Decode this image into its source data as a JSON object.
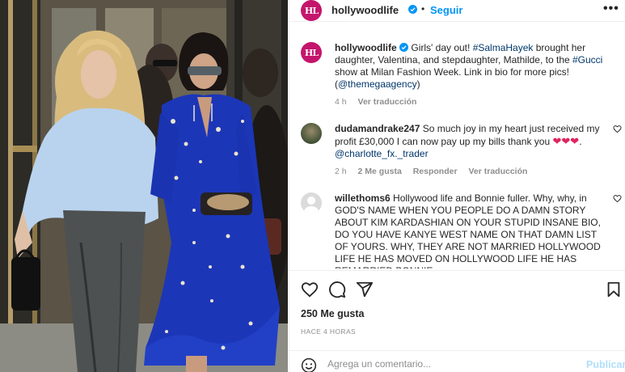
{
  "post": {
    "author": "hollywoodlife",
    "avatar_initials": "HL",
    "follow_label": "Seguir",
    "separator": "•",
    "more_label": "•••",
    "caption_parts": [
      "Girls' day out! ",
      "#SalmaHayek",
      " brought her daughter, Valentina, and stepdaughter, Mathilde, to the ",
      "#Gucci",
      " show at Milan Fashion Week. Link in bio for more pics! (",
      "@themegaagency",
      ")"
    ],
    "caption_time": "4 h",
    "caption_translate": "Ver traducción"
  },
  "comments": [
    {
      "user": "dudamandrake247",
      "text": "So much joy in my heart just received my profit £30,000 I can now pay up my bills thank you",
      "hearts": "❤❤❤",
      "tail_pre": ". ",
      "mention": "@charlotte_fx._trader",
      "time": "2 h",
      "likes": "2 Me gusta",
      "reply": "Responder",
      "translate": "Ver traducción"
    },
    {
      "user": "willethoms6",
      "text": "Hollywood life and Bonnie fuller. Why, why, in GOD'S NAME WHEN YOU PEOPLE DO A DAMN STORY ABOUT KIM KARDASHIAN ON YOUR STUPID INSANE BIO, DO YOU HAVE KANYE WEST NAME ON THAT DAMN LIST OF YOURS. WHY, THEY ARE NOT MARRIED HOLLYWOOD LIFE HE HAS MOVED ON HOLLYWOOD LIFE HE HAS REMARRIED BONNIE"
    }
  ],
  "stats": {
    "likes": "250 Me gusta",
    "time": "HACE 4 HORAS"
  },
  "composer": {
    "placeholder": "Agrega un comentario...",
    "value": "",
    "publish_label": "Publicar"
  },
  "colors": {
    "brand": "#c4156c",
    "link": "#00376b",
    "accent": "#0095f6",
    "heart": "#e0245e"
  },
  "icons": [
    "verified-icon",
    "more-icon",
    "heart-icon",
    "comment-icon",
    "share-icon",
    "save-icon",
    "emoji-icon"
  ]
}
